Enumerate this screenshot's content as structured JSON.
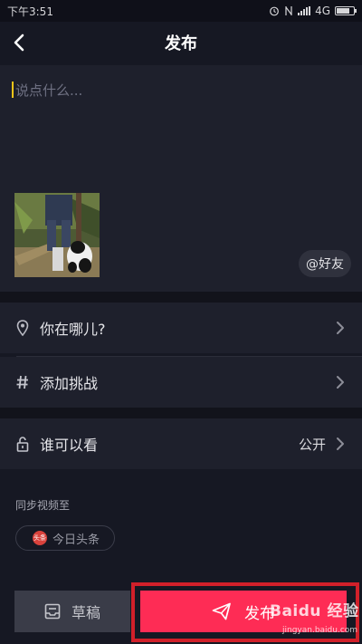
{
  "status_bar": {
    "time": "下午3:51",
    "network": "4G"
  },
  "nav": {
    "title": "发布",
    "back_icon": "chevron-left-icon"
  },
  "compose": {
    "placeholder": "说点什么...",
    "friend_button": "@好友"
  },
  "settings": {
    "location_label": "你在哪儿?",
    "challenge_label": "添加挑战",
    "visibility_label": "谁可以看",
    "visibility_value": "公开"
  },
  "sync": {
    "label": "同步视频至",
    "chip_label": "今日头条",
    "chip_logo_text": "头条"
  },
  "actions": {
    "draft_label": "草稿",
    "publish_label": "发布"
  },
  "watermark": {
    "brand": "Baidu 经验",
    "url": "jingyan.baidu.com"
  },
  "colors": {
    "background": "#161823",
    "panel": "#1e202c",
    "accent": "#fe2c55",
    "highlight_box": "#d1202a"
  }
}
